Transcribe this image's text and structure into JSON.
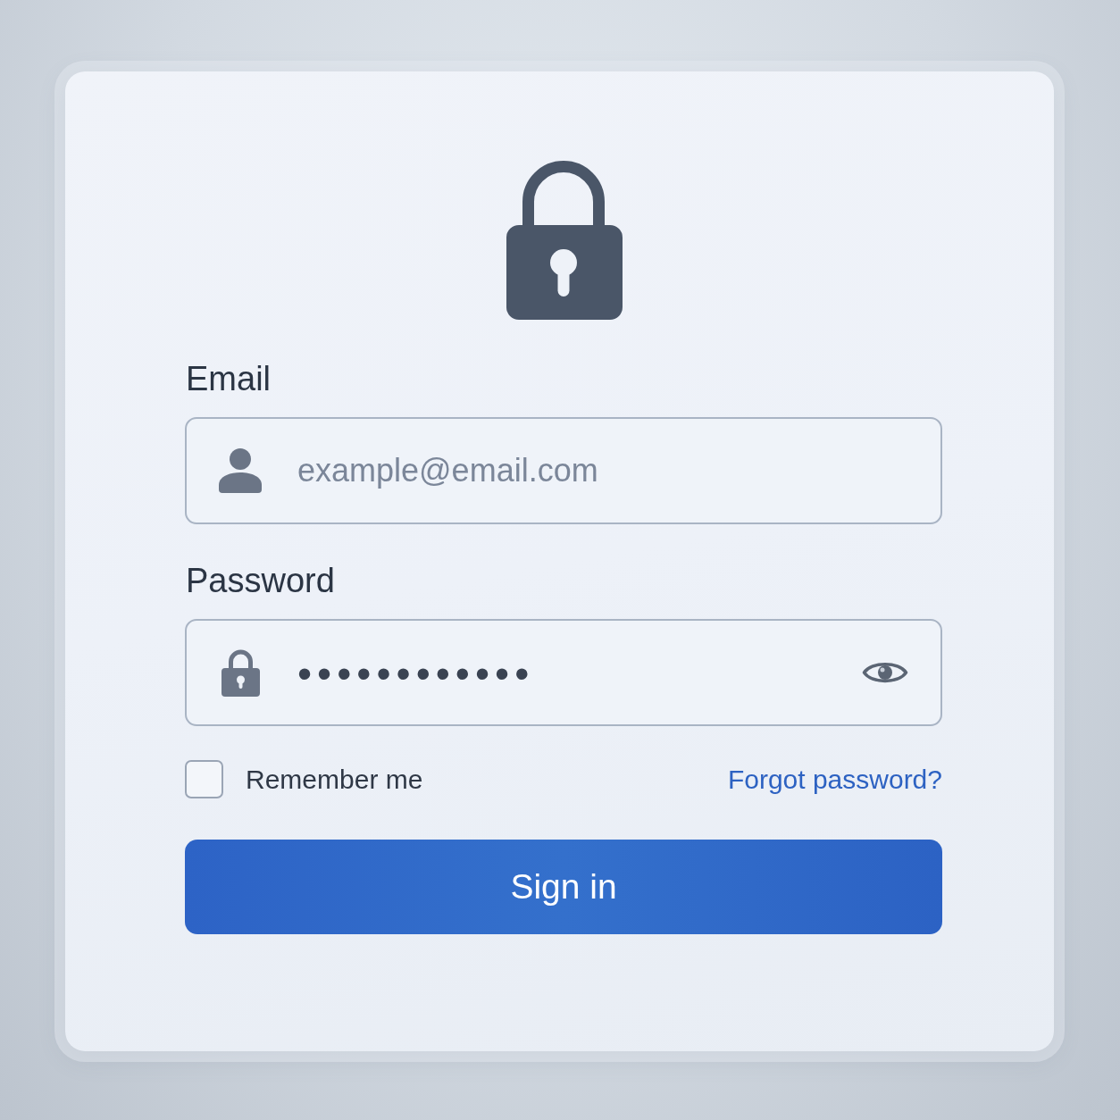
{
  "fields": [
    {
      "kind": "email",
      "label": "Email",
      "placeholder": "example@email.com"
    },
    {
      "kind": "password",
      "label": "Password",
      "value": "••••••••••••"
    }
  ],
  "remember": {
    "label": "Remember me",
    "checked": false
  },
  "forgot_link": "Forgot password?",
  "submit": "Sign in"
}
